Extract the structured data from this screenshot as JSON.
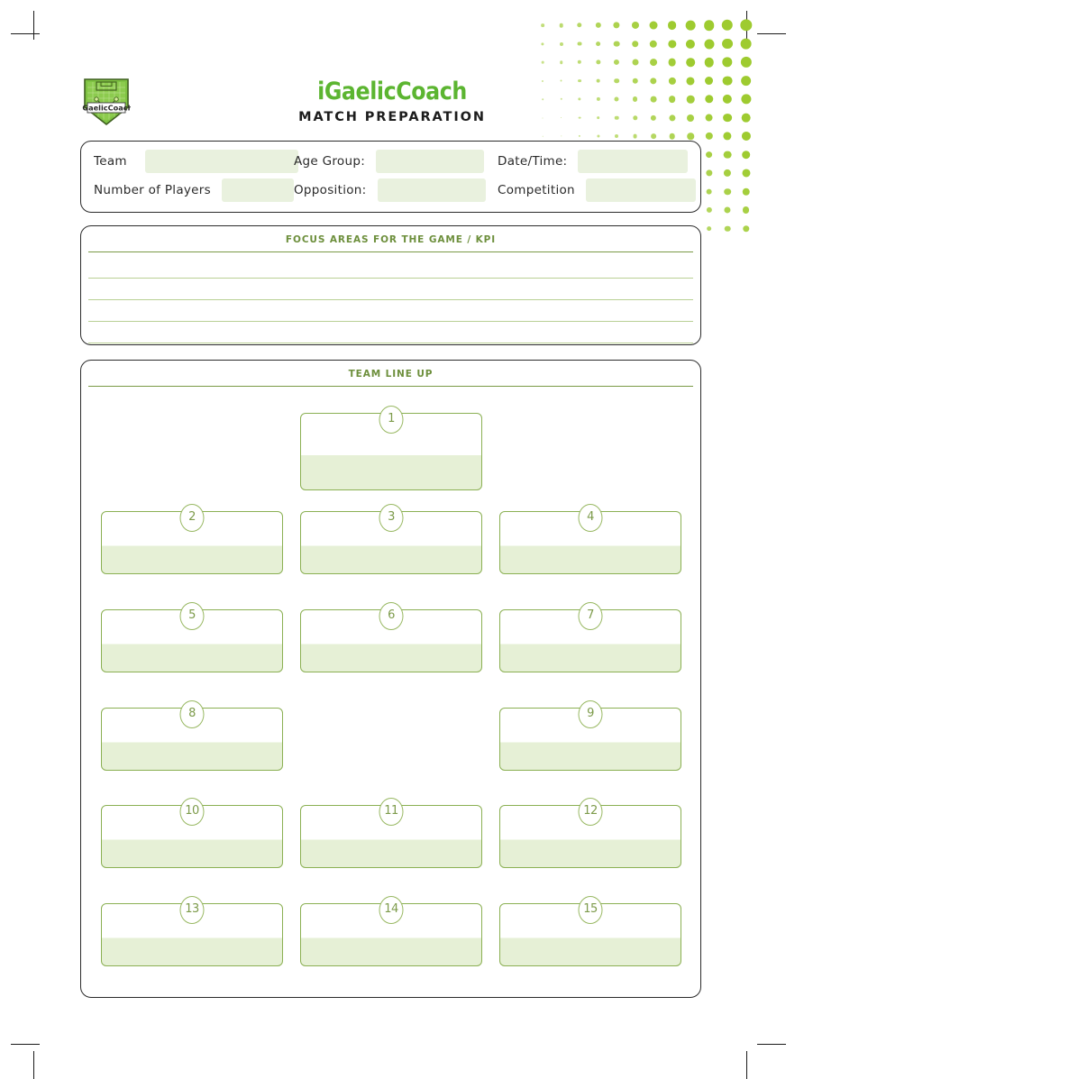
{
  "brand": {
    "name": "iGaelicCoach",
    "subtitle": "MATCH PREPARATION",
    "logo_badge_text": "iGaelicCoach",
    "accent_green": "#5cb531",
    "dot_green": "#9ecb30",
    "field_fill": "#e9f1de",
    "box_border": "#8bb053",
    "title_green": "#6d8f3c"
  },
  "details": {
    "row1": [
      {
        "label": "Team",
        "value": "",
        "field_width": 170
      },
      {
        "label": "Age Group:",
        "value": "",
        "field_width": 120
      },
      {
        "label": "Date/Time:",
        "value": "",
        "field_width": 122
      }
    ],
    "row2": [
      {
        "label": "Number  of Players",
        "value": "",
        "field_width": 80
      },
      {
        "label": "Opposition:",
        "value": "",
        "field_width": 120
      },
      {
        "label": "Competition",
        "value": "",
        "field_width": 122
      }
    ]
  },
  "focus": {
    "title": "FOCUS AREAS FOR THE GAME / KPI",
    "line_count": 4
  },
  "lineup": {
    "title": "TEAM LINE UP",
    "rows": [
      {
        "slots": [
          {
            "number": "1",
            "name": "",
            "col": 1
          }
        ]
      },
      {
        "slots": [
          {
            "number": "2",
            "name": "",
            "col": 0
          },
          {
            "number": "3",
            "name": "",
            "col": 1
          },
          {
            "number": "4",
            "name": "",
            "col": 2
          }
        ]
      },
      {
        "slots": [
          {
            "number": "5",
            "name": "",
            "col": 0
          },
          {
            "number": "6",
            "name": "",
            "col": 1
          },
          {
            "number": "7",
            "name": "",
            "col": 2
          }
        ]
      },
      {
        "slots": [
          {
            "number": "8",
            "name": "",
            "col": 0
          },
          {
            "number": "9",
            "name": "",
            "col": 2
          }
        ]
      },
      {
        "slots": [
          {
            "number": "10",
            "name": "",
            "col": 0
          },
          {
            "number": "11",
            "name": "",
            "col": 1
          },
          {
            "number": "12",
            "name": "",
            "col": 2
          }
        ]
      },
      {
        "slots": [
          {
            "number": "13",
            "name": "",
            "col": 0
          },
          {
            "number": "14",
            "name": "",
            "col": 1
          },
          {
            "number": "15",
            "name": "",
            "col": 2
          }
        ]
      }
    ]
  }
}
